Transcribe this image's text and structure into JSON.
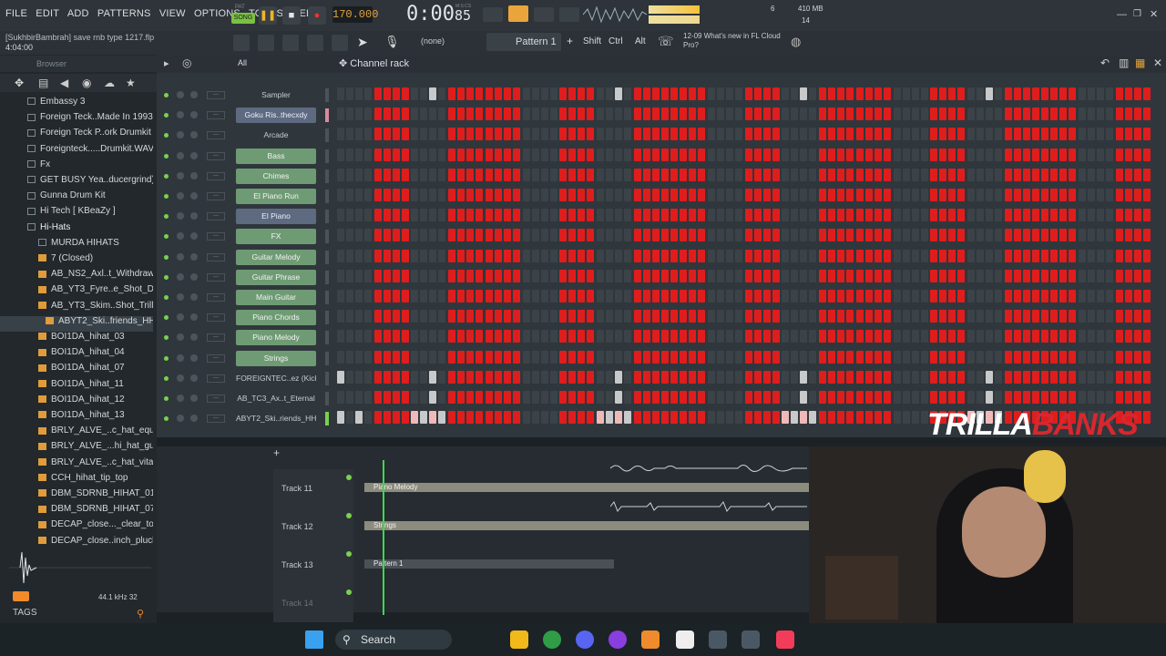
{
  "menu": [
    "FILE",
    "EDIT",
    "ADD",
    "PATTERNS",
    "VIEW",
    "OPTIONS",
    "TOOLS",
    "HELP"
  ],
  "transport": {
    "mode": "SONG",
    "pat": "PAT",
    "tempo": "170.000",
    "time": "0:00",
    "time_frac": "85",
    "msc": "M:S:CS"
  },
  "status": {
    "memory": "410 MB",
    "cpu": "14",
    "polyphony": "6"
  },
  "project": {
    "author": "[SukhbirBambrah]",
    "filename": "save rnb type 1217.flp",
    "length": "4:04:00"
  },
  "toolbar2": {
    "pattern": "Pattern 1",
    "none": "(none)",
    "shift": "Shift",
    "ctrl": "Ctrl",
    "alt": "Alt",
    "news_date": "12-09",
    "news_text": "What's new in FL Cloud Pro?"
  },
  "browser": {
    "title": "Browser",
    "filter": "All",
    "items": [
      {
        "label": "Embassy 3",
        "type": "folder",
        "indent": 1
      },
      {
        "label": "Foreign Teck..Made In 1993",
        "type": "folder",
        "indent": 1
      },
      {
        "label": "Foreign Teck P..ork Drumkit",
        "type": "folder",
        "indent": 1
      },
      {
        "label": "Foreignteck.....Drumkit.WAV",
        "type": "folder",
        "indent": 1
      },
      {
        "label": "Fx",
        "type": "folder",
        "indent": 1
      },
      {
        "label": "GET BUSY Yea..ducergrind)",
        "type": "folder",
        "indent": 1
      },
      {
        "label": "Gunna Drum Kit",
        "type": "folder",
        "indent": 1
      },
      {
        "label": "Hi Tech [ KBeaZy ]",
        "type": "folder",
        "indent": 1
      },
      {
        "label": "Hi-Hats",
        "type": "folder-open",
        "indent": 1
      },
      {
        "label": "MURDA HIHATS",
        "type": "folder",
        "indent": 2
      },
      {
        "label": "7 (Closed)",
        "type": "file",
        "indent": 2
      },
      {
        "label": "AB_NS2_Axl..t_Withdraw",
        "type": "file",
        "indent": 2
      },
      {
        "label": "AB_YT3_Fyre..e_Shot_Dat",
        "type": "file",
        "indent": 2
      },
      {
        "label": "AB_YT3_Skim..Shot_Trilly",
        "type": "file",
        "indent": 2
      },
      {
        "label": "ABYT2_Ski..friends_HH",
        "type": "file-selected",
        "indent": 3
      },
      {
        "label": "BOI1DA_hihat_03",
        "type": "file",
        "indent": 2
      },
      {
        "label": "BOI1DA_hihat_04",
        "type": "file",
        "indent": 2
      },
      {
        "label": "BOI1DA_hihat_07",
        "type": "file",
        "indent": 2
      },
      {
        "label": "BOI1DA_hihat_11",
        "type": "file",
        "indent": 2
      },
      {
        "label": "BOI1DA_hihat_12",
        "type": "file",
        "indent": 2
      },
      {
        "label": "BOI1DA_hihat_13",
        "type": "file",
        "indent": 2
      },
      {
        "label": "BRLY_ALVE_..c_hat_equity",
        "type": "file",
        "indent": 2
      },
      {
        "label": "BRLY_ALVE_...hi_hat_guy",
        "type": "file",
        "indent": 2
      },
      {
        "label": "BRLY_ALVE_..c_hat_vitalic",
        "type": "file",
        "indent": 2
      },
      {
        "label": "CCH_hihat_tip_top",
        "type": "file",
        "indent": 2
      },
      {
        "label": "DBM_SDRNB_HIHAT_01",
        "type": "file",
        "indent": 2
      },
      {
        "label": "DBM_SDRNB_HIHAT_07",
        "type": "file",
        "indent": 2
      },
      {
        "label": "DECAP_close..._clear_tone",
        "type": "file",
        "indent": 2
      },
      {
        "label": "DECAP_close..inch_pluck",
        "type": "file",
        "indent": 2
      }
    ],
    "sample_rate": "44.1 kHz",
    "bits": "32",
    "tags": "TAGS"
  },
  "channel_rack": {
    "title": "Channel rack",
    "channels": [
      {
        "name": "Sampler",
        "style": "plain",
        "pattern": "A"
      },
      {
        "name": "Goku Ris..thecxdy",
        "style": "purple",
        "pattern": "B"
      },
      {
        "name": "Arcade",
        "style": "plain",
        "pattern": "B"
      },
      {
        "name": "Bass",
        "style": "green",
        "pattern": "B"
      },
      {
        "name": "Chimes",
        "style": "green",
        "pattern": "B"
      },
      {
        "name": "El Piano Run",
        "style": "green",
        "pattern": "B"
      },
      {
        "name": "El Piano",
        "style": "purple",
        "pattern": "B"
      },
      {
        "name": "FX",
        "style": "green",
        "pattern": "B"
      },
      {
        "name": "Guitar Melody",
        "style": "green",
        "pattern": "B"
      },
      {
        "name": "Guitar Phrase",
        "style": "green",
        "pattern": "B"
      },
      {
        "name": "Main Guitar",
        "style": "green",
        "pattern": "B"
      },
      {
        "name": "Piano Chords",
        "style": "green",
        "pattern": "B"
      },
      {
        "name": "Piano Melody",
        "style": "green",
        "pattern": "B"
      },
      {
        "name": "Strings",
        "style": "green",
        "pattern": "B"
      },
      {
        "name": "FOREIGNTEC..ez (Kick)",
        "style": "plain",
        "pattern": "C"
      },
      {
        "name": "AB_TC3_Ax..t_Eternal",
        "style": "plain",
        "pattern": "A"
      },
      {
        "name": "ABYT2_Ski..riends_HH",
        "style": "plain",
        "pattern": "D"
      }
    ]
  },
  "playlist": {
    "tracks": [
      {
        "name": "Track 11",
        "clip": "Piano Melody"
      },
      {
        "name": "Track 12",
        "clip": "Strings"
      },
      {
        "name": "Track 13",
        "clip": "Pattern 1"
      },
      {
        "name": "Track 14",
        "clip": ""
      }
    ]
  },
  "overlay": {
    "brand1": "TRILLA",
    "brand2": "BANKS"
  },
  "taskbar": {
    "search": "Search"
  }
}
